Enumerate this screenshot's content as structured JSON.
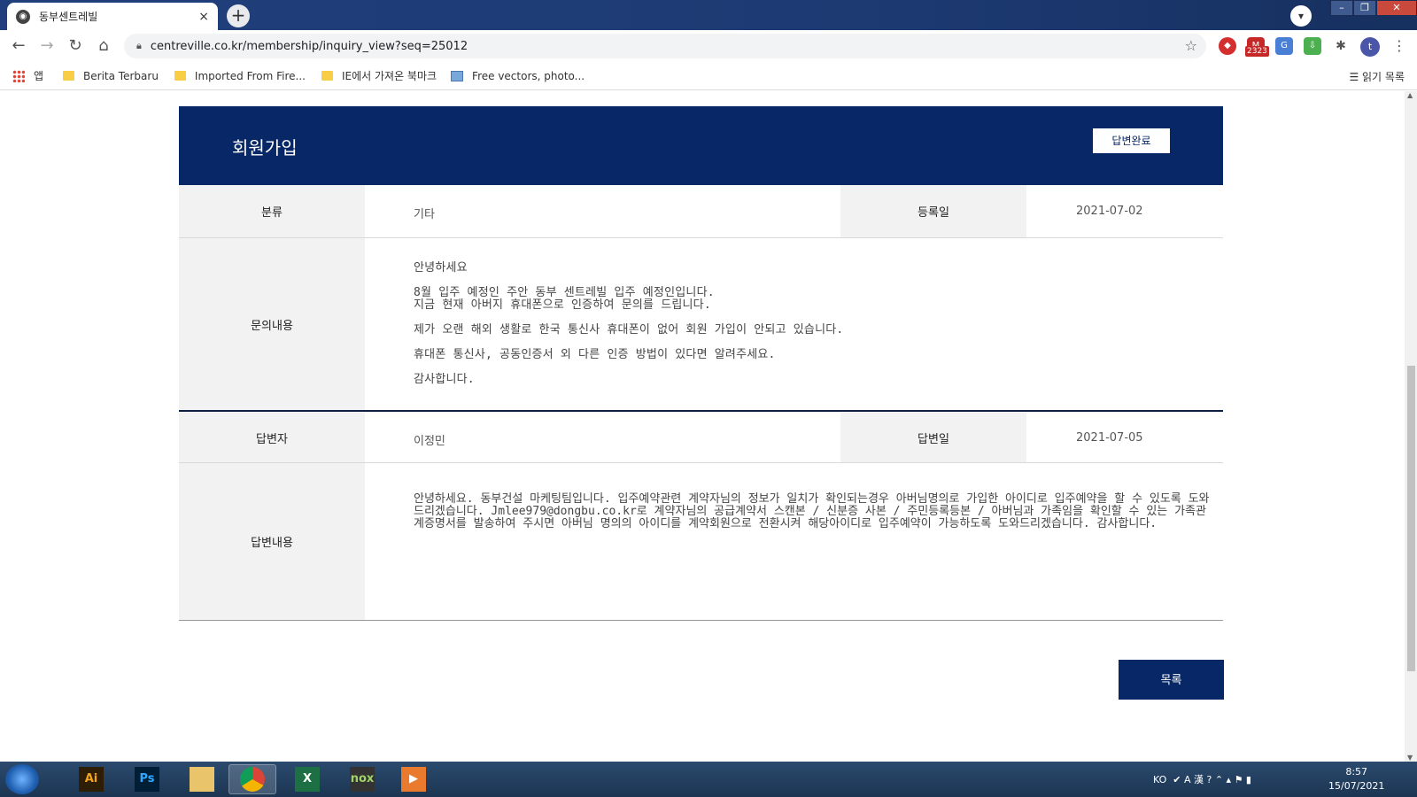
{
  "browser": {
    "tab_title": "동부센트레빌",
    "tab_close": "×",
    "new_tab": "+",
    "url": "centreville.co.kr/membership/inquiry_view?seq=25012",
    "ext_badge": "2323",
    "avatar_letter": "t",
    "bookmarks": [
      {
        "label": "앱",
        "icon": "apps-icon"
      },
      {
        "label": "Berita Terbaru",
        "icon": "folder-icon"
      },
      {
        "label": "Imported From Fire...",
        "icon": "folder-icon"
      },
      {
        "label": "IE에서 가져온 북마크",
        "icon": "folder-icon"
      },
      {
        "label": "Free vectors, photo...",
        "icon": "image-icon"
      }
    ],
    "reading_list": "읽기 목록"
  },
  "inquiry": {
    "title": "회원가입",
    "status": "답변완료",
    "category_label": "분류",
    "category_value": "기타",
    "date_label": "등록일",
    "date_value": "2021-07-02",
    "content_label": "문의내용",
    "content_lines": [
      "안녕하세요",
      "8월 입주  예정인  주안 동부 센트레빌 입주 예정인입니다.",
      "지금 현재 아버지 휴대폰으로 인증하여 문의를 드립니다.",
      "제가 오랜 해외 생활로 한국 통신사 휴대폰이 없어 회원 가입이 안되고 있습니다.",
      "휴대폰 통신사, 공동인증서 외 다른 인증 방법이 있다면 알려주세요.",
      "감사합니다."
    ],
    "answerer_label": "답변자",
    "answerer_value": "이정민",
    "answer_date_label": "답변일",
    "answer_date_value": "2021-07-05",
    "answer_label": "답변내용",
    "answer_text": "안녕하세요. 동부건설 마케팅팀입니다. 입주예약관련 계약자님의 정보가 일치가 확인되는경우 아버님명의로 가입한 아이디로 입주예약을 할 수 있도록 도와드리겠습니다. Jmlee979@dongbu.co.kr로  계약자님의 공급계약서 스캔본 / 신분증 사본 / 주민등록등본 / 아버님과 가족임을 확인할 수 있는 가족관계증명서를 발송하여 주시면 아버님 명의의 아이디를 계약회원으로 전환시켜 해당아이디로 입주예약이 가능하도록 도와드리겠습니다. 감사합니다.",
    "list_button": "목록"
  },
  "taskbar": {
    "apps": [
      {
        "label": "Ai",
        "icon": "illustrator-icon",
        "color": "#f7a21b",
        "bg": "#2d1e05"
      },
      {
        "label": "Ps",
        "icon": "photoshop-icon",
        "color": "#31a8ff",
        "bg": "#001e36"
      },
      {
        "label": "",
        "icon": "file-explorer-icon",
        "color": "#fff",
        "bg": "#e9c46a"
      },
      {
        "label": "",
        "icon": "chrome-icon",
        "color": "#fff",
        "bg": "#4285f4"
      },
      {
        "label": "X",
        "icon": "excel-icon",
        "color": "#fff",
        "bg": "#1d7044"
      },
      {
        "label": "nox",
        "icon": "nox-icon",
        "color": "#9fd36a",
        "bg": "#333"
      },
      {
        "label": "▶",
        "icon": "media-player-icon",
        "color": "#fff",
        "bg": "#e97a2e"
      }
    ],
    "lang": "KO",
    "time": "8:57",
    "date": "15/07/2021"
  },
  "colors": {
    "brand_navy": "#072766",
    "label_bg": "#f2f2f2"
  }
}
